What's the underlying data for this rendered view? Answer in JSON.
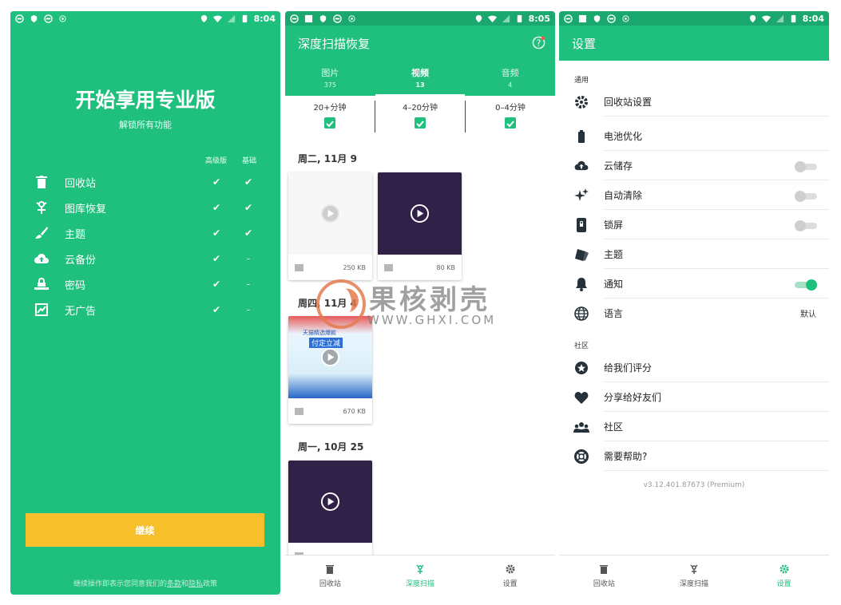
{
  "status_bars": [
    {
      "time": "8:04"
    },
    {
      "time": "8:05"
    },
    {
      "time": "8:04"
    }
  ],
  "upgrade": {
    "title": "开始享用专业版",
    "subtitle": "解锁所有功能",
    "col_premium": "高级版",
    "col_basic": "基础",
    "features": [
      {
        "icon": "trash-icon",
        "label": "回收站",
        "premium": "✔",
        "basic": "✔"
      },
      {
        "icon": "recovery-icon",
        "label": "图库恢复",
        "premium": "✔",
        "basic": "✔"
      },
      {
        "icon": "theme-brush-icon",
        "label": "主题",
        "premium": "✔",
        "basic": "✔"
      },
      {
        "icon": "cloud-upload-icon",
        "label": "云备份",
        "premium": "✔",
        "basic": "-"
      },
      {
        "icon": "password-icon",
        "label": "密码",
        "premium": "✔",
        "basic": "-"
      },
      {
        "icon": "no-ads-icon",
        "label": "无广告",
        "premium": "✔",
        "basic": "-"
      }
    ],
    "continue_label": "继续",
    "footer_prefix": "继续操作即表示您同意我们的",
    "footer_terms": "条款",
    "footer_and": "和",
    "footer_privacy": "隐私",
    "footer_suffix": "政策"
  },
  "deepscan": {
    "title": "深度扫描恢复",
    "tabs": [
      {
        "label": "图片",
        "count": "375"
      },
      {
        "label": "视频",
        "count": "13"
      },
      {
        "label": "音频",
        "count": "4"
      }
    ],
    "filters": [
      {
        "label": "20+分钟"
      },
      {
        "label": "4–20分钟"
      },
      {
        "label": "0–4分钟"
      }
    ],
    "groups": [
      {
        "date": "周二, 11月 9",
        "items": [
          {
            "size": "250 KB"
          },
          {
            "size": "80 KB"
          }
        ]
      },
      {
        "date": "周四, 11月 4",
        "items": [
          {
            "size": "670 KB"
          }
        ]
      },
      {
        "date": "周一, 10月 25",
        "items": [
          {
            "size": ""
          }
        ]
      }
    ],
    "ad_text_1": "天猫精选爆款",
    "ad_text_2": "付定立减"
  },
  "settings": {
    "title": "设置",
    "section_general": "通用",
    "items_general": [
      {
        "icon": "gear-icon",
        "label": "回收站设置"
      },
      {
        "icon": "battery-icon",
        "label": "电池优化"
      },
      {
        "icon": "cloud-upload-icon",
        "label": "云储存",
        "toggle": "off"
      },
      {
        "icon": "sparkle-icon",
        "label": "自动清除",
        "toggle": "off"
      },
      {
        "icon": "lock-screen-icon",
        "label": "锁屏",
        "toggle": "off"
      },
      {
        "icon": "theme-brush-icon",
        "label": "主题"
      },
      {
        "icon": "bell-icon",
        "label": "通知",
        "toggle": "on"
      },
      {
        "icon": "globe-icon",
        "label": "语言",
        "value": "默认"
      }
    ],
    "section_community": "社区",
    "items_community": [
      {
        "icon": "star-icon",
        "label": "给我们评分"
      },
      {
        "icon": "heart-icon",
        "label": "分享给好友们"
      },
      {
        "icon": "people-icon",
        "label": "社区"
      },
      {
        "icon": "lifebuoy-icon",
        "label": "需要帮助?"
      }
    ],
    "version": "v3.12.401.87673 (Premium)"
  },
  "bottom_nav": [
    {
      "icon": "trash-icon",
      "label": "回收站"
    },
    {
      "icon": "deep-scan-icon",
      "label": "深度扫描"
    },
    {
      "icon": "gear-icon",
      "label": "设置"
    }
  ],
  "watermark": {
    "cn": "果核剥壳",
    "en": "WWW.GHXI.COM"
  },
  "colors": {
    "brand": "#1fbf7e",
    "button": "#f7c02b",
    "video_bg": "#2f2147"
  }
}
